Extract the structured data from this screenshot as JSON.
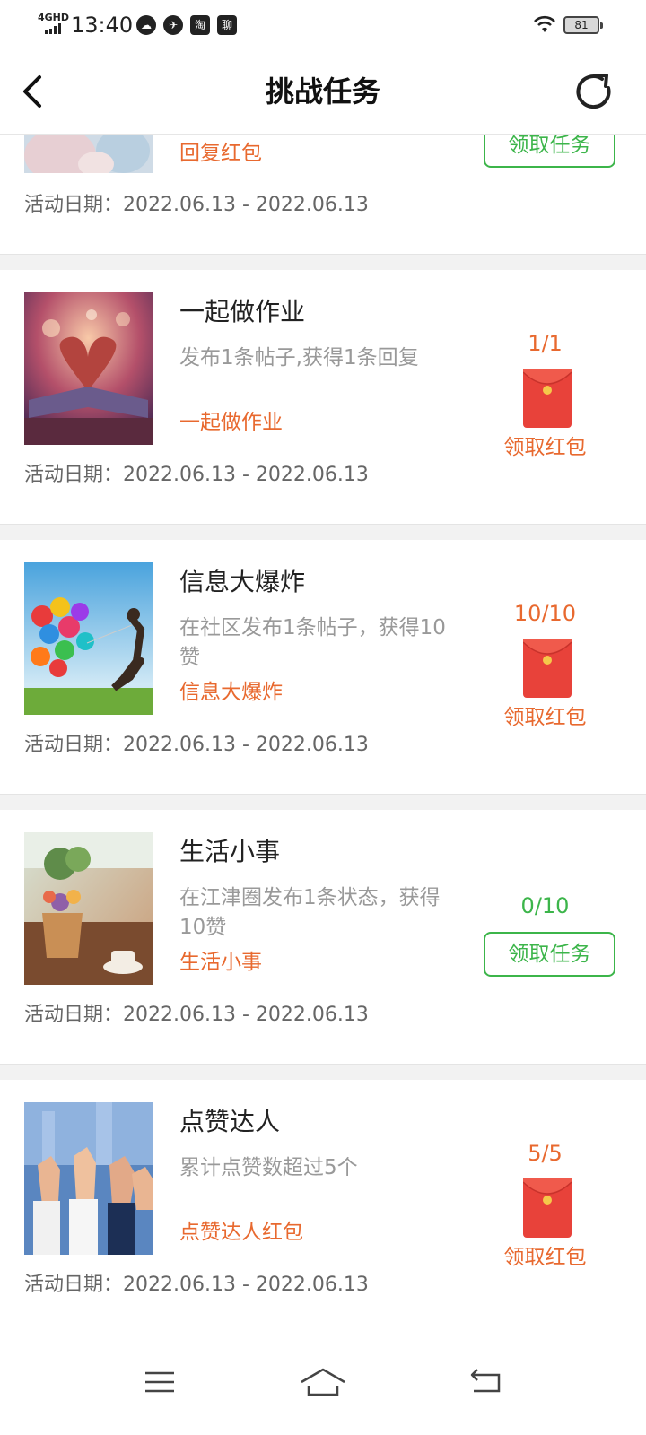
{
  "status_bar": {
    "network": "4GHD",
    "time": "13:40",
    "app_icons": [
      "weather-icon",
      "compass-icon",
      "taobao-icon",
      "app-icon"
    ],
    "app_icon_glyphs": [
      "☁",
      "✈",
      "淘",
      "聊"
    ],
    "battery": "81"
  },
  "header": {
    "title": "挑战任务"
  },
  "tasks": [
    {
      "title": "",
      "description": "",
      "tag": "回复红包",
      "date": "活动日期：2022.06.13 - 2022.06.13",
      "count": "",
      "action": "领取任务",
      "image": "photo-girl"
    },
    {
      "title": "一起做作业",
      "description": "发布1条帖子,获得1条回复",
      "tag": "一起做作业",
      "date": "活动日期：2022.06.13 - 2022.06.13",
      "count": "1/1",
      "action": "领取红包",
      "image": "photo-book-heart"
    },
    {
      "title": "信息大爆炸",
      "description": "在社区发布1条帖子，获得10赞",
      "tag": "信息大爆炸",
      "date": "活动日期：2022.06.13 - 2022.06.13",
      "count": "10/10",
      "action": "领取红包",
      "image": "photo-balloons"
    },
    {
      "title": "生活小事",
      "description": "在江津圈发布1条状态，获得10赞",
      "tag": "生活小事",
      "date": "活动日期：2022.06.13 - 2022.06.13",
      "count": "0/10",
      "action": "领取任务",
      "image": "photo-teapot"
    },
    {
      "title": "点赞达人",
      "description": "累计点赞数超过5个",
      "tag": "点赞达人红包",
      "date": "活动日期：2022.06.13 - 2022.06.13",
      "count": "5/5",
      "action": "领取红包",
      "image": "photo-thumbs-up"
    }
  ],
  "colors": {
    "accent_orange": "#e8692f",
    "accent_green": "#3cb54a",
    "envelope_red": "#e8423a"
  },
  "bottom_nav": {
    "icons": [
      "menu-icon",
      "home-icon",
      "back-icon"
    ]
  }
}
